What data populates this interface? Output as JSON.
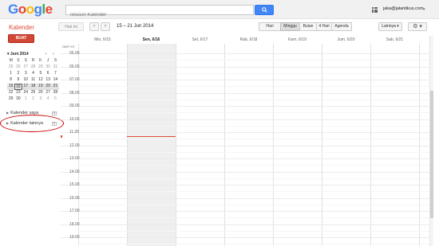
{
  "header": {
    "logo": [
      "G",
      "o",
      "o",
      "g",
      "l",
      "e"
    ],
    "logo_colors": [
      "#4285f4",
      "#ea4335",
      "#fbbc05",
      "#4285f4",
      "#34a853",
      "#ea4335"
    ],
    "search_placeholder": "Telusuri Kalender",
    "account": "jaka@jalantikus.com"
  },
  "toolbar": {
    "app_title": "Kalender",
    "today_label": "Hari ini",
    "prev": "‹",
    "next": "›",
    "date_range": "15 – 21 Jun 2014",
    "views": [
      "Hari",
      "Minggu",
      "Bulan",
      "4 Hari",
      "Agenda"
    ],
    "active_view": "Minggu",
    "more_label": "Lainnya ▾",
    "gear": "⚙ ▾"
  },
  "sidebar": {
    "create_label": "BUAT",
    "mini_month": "▾ Juni 2014",
    "mini_prev": "‹",
    "mini_next": "›",
    "dow": [
      "M",
      "S",
      "S",
      "R",
      "K",
      "J",
      "S"
    ],
    "weeks": [
      [
        "25",
        "26",
        "27",
        "28",
        "29",
        "30",
        "31"
      ],
      [
        "1",
        "2",
        "3",
        "4",
        "5",
        "6",
        "7"
      ],
      [
        "8",
        "9",
        "10",
        "11",
        "12",
        "13",
        "14"
      ],
      [
        "15",
        "16",
        "17",
        "18",
        "19",
        "20",
        "21"
      ],
      [
        "22",
        "23",
        "24",
        "25",
        "26",
        "27",
        "28"
      ],
      [
        "29",
        "30",
        "1",
        "2",
        "3",
        "4",
        "5"
      ]
    ],
    "my_calendars": "Kalender saya",
    "other_calendars": "Kalender lainnya"
  },
  "calendar": {
    "timezone": "GMT+07",
    "days": [
      "Min, 6/15",
      "Sen, 6/16",
      "Sel, 6/17",
      "Rab, 6/18",
      "Kam, 6/19",
      "Jum, 6/20",
      "Sab, 6/21"
    ],
    "today_index": 1,
    "hours": [
      "05.00",
      "06.00",
      "07.00",
      "08.00",
      "09.00",
      "10.00",
      "11.00",
      "12.00",
      "13.00",
      "14.00",
      "15.00",
      "16.00",
      "17.00",
      "18.00",
      "19.00"
    ]
  }
}
